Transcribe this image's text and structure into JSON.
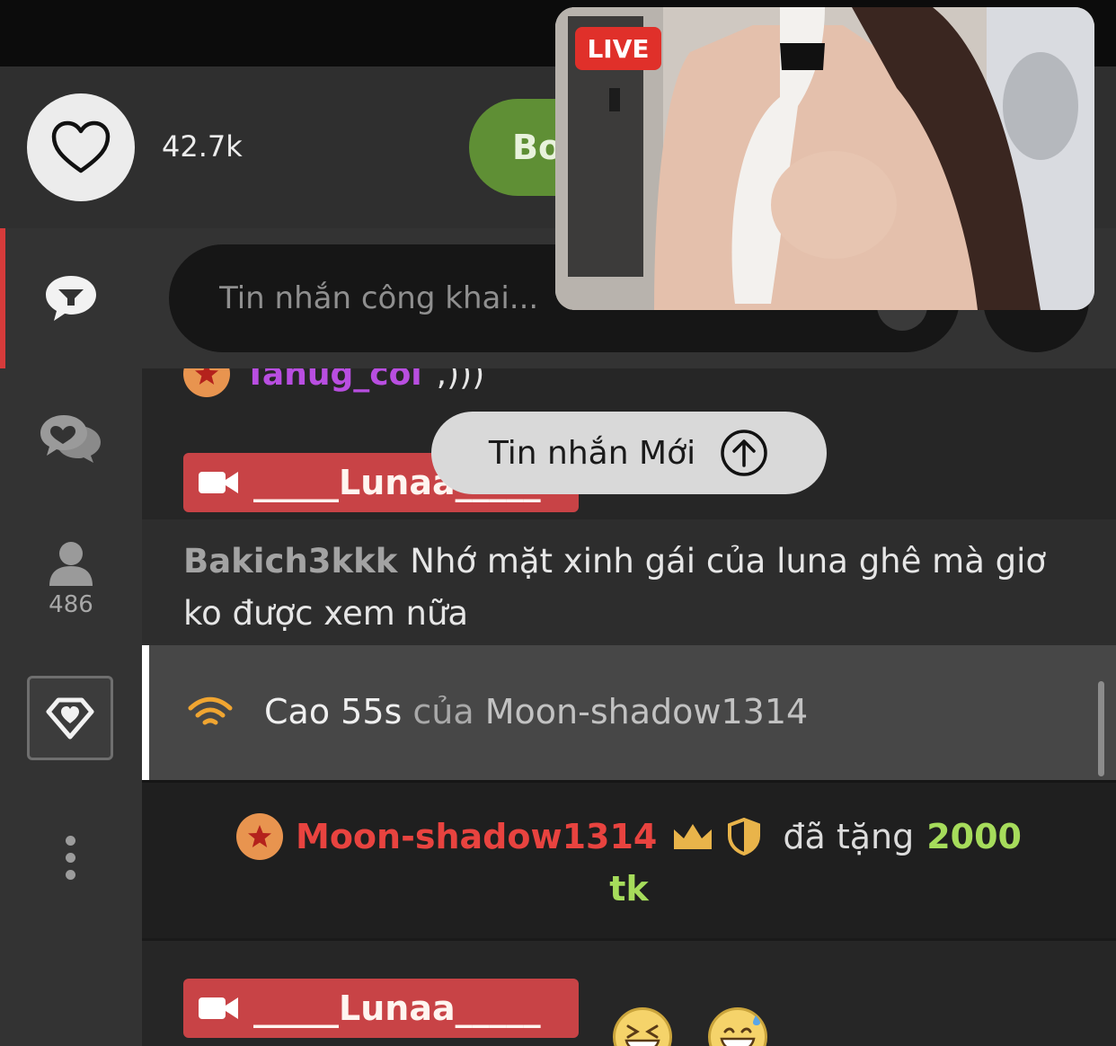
{
  "header": {
    "likes": "42.7k",
    "follow_label": "Bo"
  },
  "sidebar": {
    "viewers_count": "486"
  },
  "composer": {
    "placeholder": "Tin nhắn công khai..."
  },
  "live_preview": {
    "badge": "LIVE"
  },
  "new_messages": {
    "label": "Tin nhắn Mới"
  },
  "chat": {
    "partial": {
      "user": "Tanug_coi",
      "text": ",)))"
    },
    "host_name": "_____Lunaa_____",
    "message": {
      "user": "Bakich3kkk",
      "text": "Nhớ mặt xinh gái của luna ghê mà giơ ko được xem nữa"
    },
    "pinned": {
      "label": "Cao 55s",
      "of": "của",
      "user": "Moon-shadow1314"
    },
    "gift": {
      "user": "Moon-shadow1314",
      "verb": "đã tặng",
      "amount": "2000",
      "unit": "tk"
    },
    "host_name_2": "_____Lunaa_____"
  },
  "colors": {
    "accent_red": "#d63b3b",
    "host_tag": "#c84346",
    "follow_green": "#5f8f35",
    "gift_amount": "#a6dc5b",
    "username_purple": "#b84ee0"
  }
}
